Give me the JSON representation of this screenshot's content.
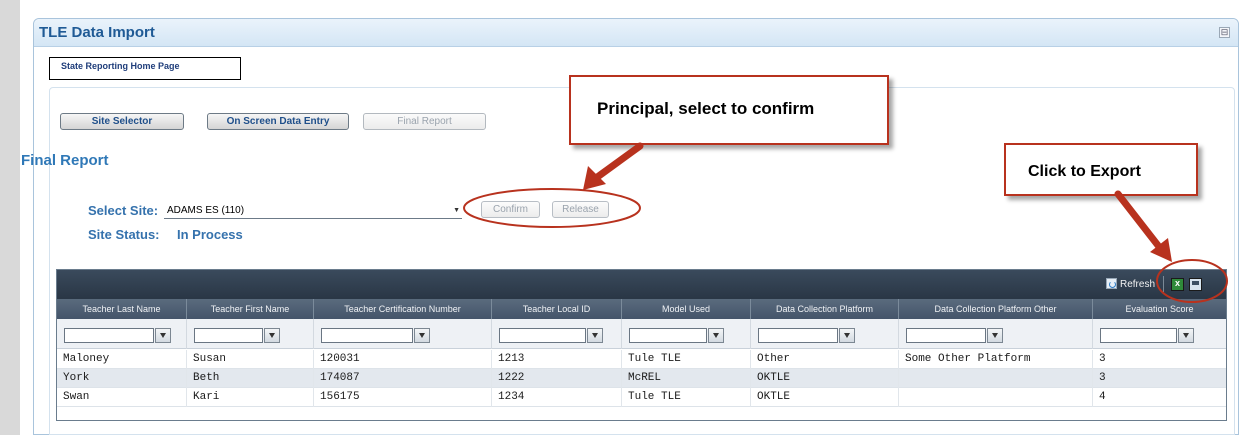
{
  "panel": {
    "title": "TLE Data Import",
    "collapse_glyph": "⊟"
  },
  "home_link": "State Reporting Home Page",
  "nav": {
    "site_selector": "Site Selector",
    "on_screen_data_entry": "On Screen Data Entry",
    "final_report": "Final Report"
  },
  "section_title": "Final Report",
  "site": {
    "label": "Select Site:",
    "selected": "ADAMS ES (110)",
    "status_label": "Site Status:",
    "status_value": "In Process"
  },
  "actions": {
    "confirm": "Confirm",
    "release": "Release"
  },
  "annotations": {
    "confirm_callout": "Principal, select to confirm",
    "export_callout": "Click to Export",
    "accent_color": "#b8321e"
  },
  "grid": {
    "refresh_label": "Refresh",
    "columns": [
      "Teacher Last Name",
      "Teacher First Name",
      "Teacher Certification Number",
      "Teacher Local ID",
      "Model Used",
      "Data Collection Platform",
      "Data Collection Platform Other",
      "Evaluation Score"
    ],
    "rows": [
      [
        "Maloney",
        "Susan",
        "120031",
        "1213",
        "Tule TLE",
        "Other",
        "Some Other Platform",
        "3"
      ],
      [
        "York",
        "Beth",
        "174087",
        "1222",
        "McREL",
        "OKTLE",
        "",
        "3"
      ],
      [
        "Swan",
        "Kari",
        "156175",
        "1234",
        "Tule TLE",
        "OKTLE",
        "",
        "4"
      ]
    ]
  }
}
